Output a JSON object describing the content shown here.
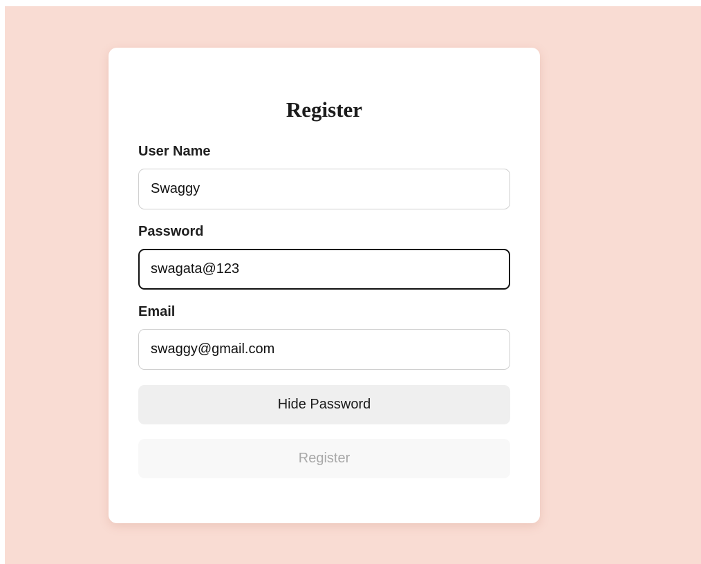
{
  "form": {
    "title": "Register",
    "username": {
      "label": "User Name",
      "value": "Swaggy"
    },
    "password": {
      "label": "Password",
      "value": "swagata@123"
    },
    "email": {
      "label": "Email",
      "value": "swaggy@gmail.com"
    },
    "toggle_label": "Hide Password",
    "submit_label": "Register"
  },
  "colors": {
    "page_background": "#f9dcd3",
    "card_background": "#ffffff",
    "toggle_button": "#efefef",
    "submit_button_disabled": "#f8f8f8"
  }
}
